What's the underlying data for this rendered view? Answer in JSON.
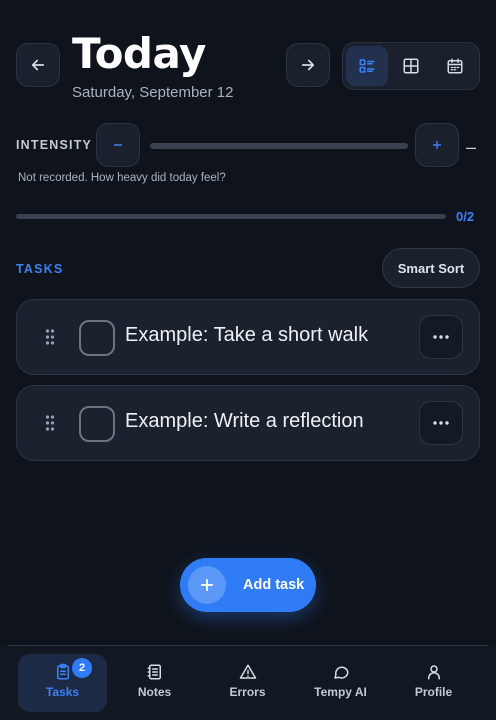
{
  "header": {
    "title": "Today",
    "date": "Saturday, September 12",
    "back_icon": "arrow-left-icon",
    "forward_icon": "arrow-right-icon",
    "view_modes": [
      {
        "icon": "list-view-icon",
        "active": true
      },
      {
        "icon": "grid-view-icon",
        "active": false
      },
      {
        "icon": "calendar-view-icon",
        "active": false
      }
    ]
  },
  "intensity": {
    "label": "INTENSITY",
    "value_text": "–",
    "hint": "Not recorded. How heavy did today feel?"
  },
  "progress": {
    "text": "0/2",
    "fraction": 0
  },
  "tasks": {
    "label": "TASKS",
    "smart_sort_label": "Smart Sort",
    "items": [
      {
        "text": "Example: Take a short walk",
        "done": false
      },
      {
        "text": "Example: Write a reflection",
        "done": false
      }
    ]
  },
  "add_task": {
    "label": "Add task"
  },
  "nav": {
    "items": [
      {
        "label": "Tasks",
        "icon": "clipboard-icon",
        "badge": "2",
        "active": true
      },
      {
        "label": "Notes",
        "icon": "notebook-icon",
        "active": false
      },
      {
        "label": "Errors",
        "icon": "warning-triangle-icon",
        "active": false
      },
      {
        "label": "Tempy AI",
        "icon": "chat-bubble-icon",
        "active": false
      },
      {
        "label": "Profile",
        "icon": "user-icon",
        "active": false
      }
    ]
  },
  "colors": {
    "background": "#0f141c",
    "accent": "#2f7cf6",
    "card": "#1b222d"
  }
}
